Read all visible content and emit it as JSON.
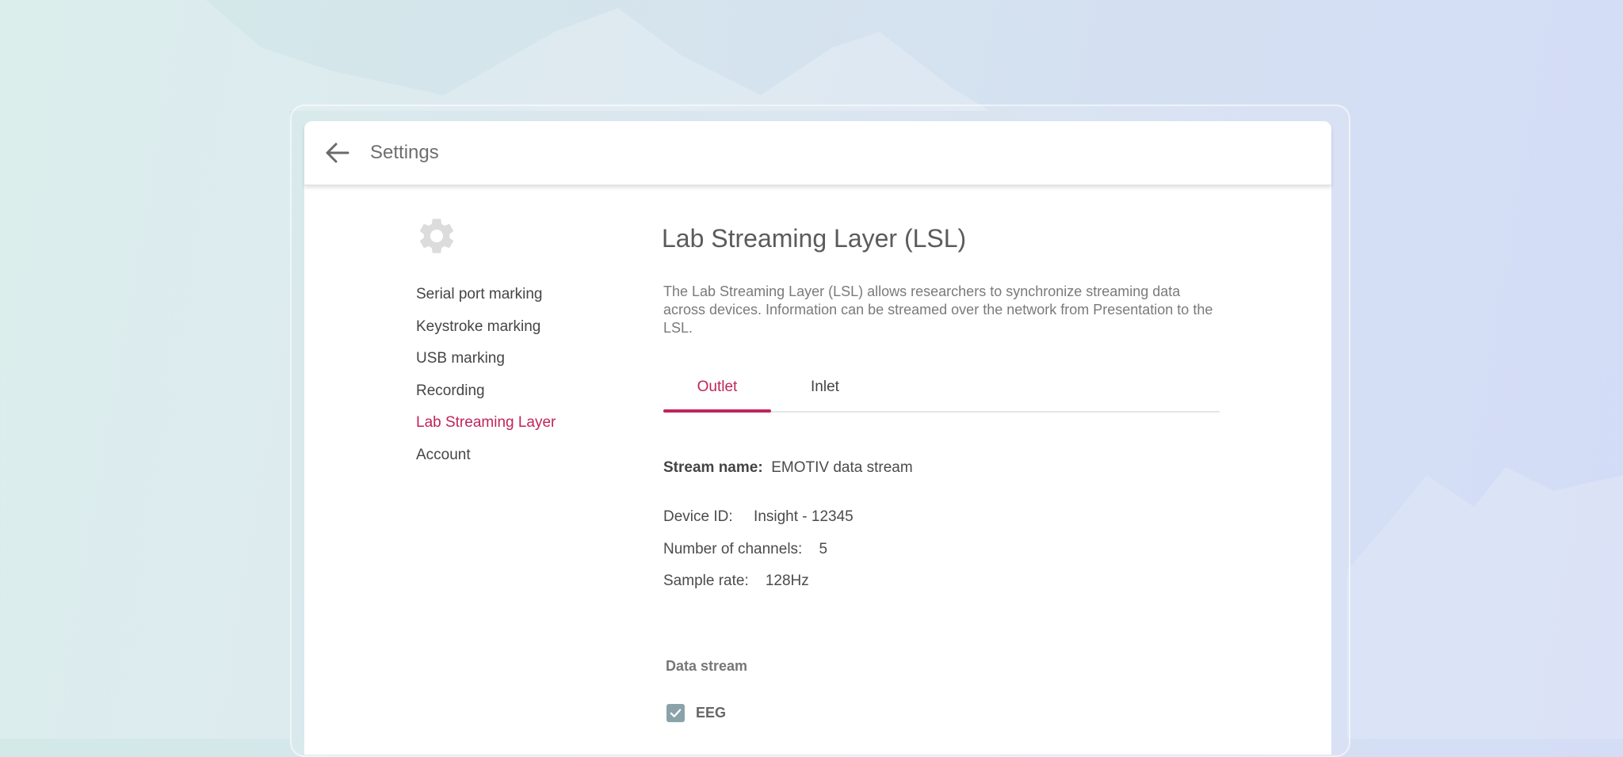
{
  "header": {
    "title": "Settings"
  },
  "sidebar": {
    "items": [
      {
        "label": "Serial port marking"
      },
      {
        "label": "Keystroke marking"
      },
      {
        "label": "USB marking"
      },
      {
        "label": "Recording"
      },
      {
        "label": "Lab Streaming Layer"
      },
      {
        "label": "Account"
      }
    ],
    "active": "Lab Streaming Layer"
  },
  "main": {
    "title": "Lab Streaming Layer (LSL)",
    "description": "The Lab Streaming Layer (LSL) allows researchers to synchronize streaming data across devices. Information can be streamed over the network from Presentation to the LSL.",
    "tabs": [
      {
        "label": "Outlet"
      },
      {
        "label": "Inlet"
      }
    ],
    "active_tab": "Outlet",
    "stream_name": {
      "label": "Stream name:",
      "value": "EMOTIV data stream"
    },
    "device_id": {
      "label": "Device ID:",
      "value": "Insight - 12345"
    },
    "channels": {
      "label": "Number of channels:",
      "value": "5"
    },
    "sample_rate": {
      "label": "Sample rate:",
      "value": "128Hz"
    },
    "data_stream": {
      "label": "Data stream",
      "options": [
        {
          "label": "EEG",
          "checked": true
        }
      ]
    }
  },
  "colors": {
    "accent": "#c0245c",
    "checkbox": "#8aa3aa"
  },
  "icons": {
    "back": "arrow-left-icon",
    "settings": "gear-icon",
    "check": "check-icon"
  }
}
